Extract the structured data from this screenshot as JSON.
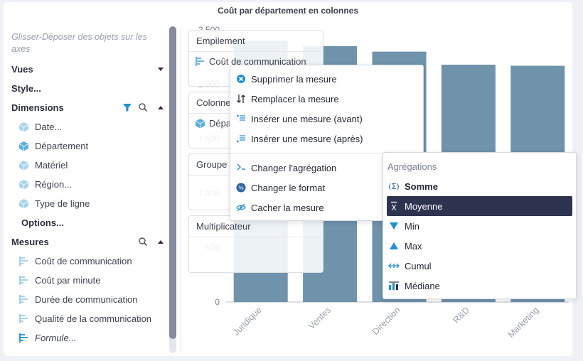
{
  "title": "Coût par département en colonnes",
  "sidebar": {
    "hint": "Glisser-Déposer des objets sur les axes",
    "vues": "Vues",
    "style": "Style...",
    "dimensions_label": "Dimensions",
    "dimensions": [
      "Date...",
      "Département",
      "Matériel",
      "Région...",
      "Type de ligne"
    ],
    "options": "Options...",
    "mesures_label": "Mesures",
    "mesures": [
      "Coût de communication",
      "Coût par minute",
      "Durée de communication",
      "Qualité de la communication",
      "Formule..."
    ]
  },
  "panels": {
    "empilement": "Empilement",
    "empilement_item": "Coût de communication",
    "colonnes": "Colonnes",
    "colonnes_item": "Département",
    "groupe": "Groupe",
    "multiplicateur": "Multiplicateur"
  },
  "context_menu": {
    "items": [
      "Supprimer la mesure",
      "Remplacer la mesure",
      "Insérer une mesure (avant)",
      "Insérer une mesure (après)",
      "Changer l'agrégation",
      "Changer le format",
      "Cacher la mesure"
    ]
  },
  "aggregations": {
    "header": "Agrégations",
    "items": [
      {
        "label": "Somme",
        "icon": "sigma-icon",
        "bold": true
      },
      {
        "label": "Moyenne",
        "icon": "xbar-icon",
        "selected": true
      },
      {
        "label": "Min",
        "icon": "triangle-down-icon"
      },
      {
        "label": "Max",
        "icon": "triangle-up-icon"
      },
      {
        "label": "Cumul",
        "icon": "cumul-icon"
      },
      {
        "label": "Médiane",
        "icon": "median-icon"
      }
    ]
  },
  "colors": {
    "bar": "#6f93ab",
    "accent": "#2e3350",
    "icon_blue": "#1e90d6",
    "dim_icon": "#a9d3ea"
  },
  "chart_data": {
    "type": "bar",
    "categories": [
      "Juridique",
      "Ventes",
      "Direction",
      "R&D",
      "Marketing"
    ],
    "values": [
      2400,
      2350,
      2300,
      2180,
      2170
    ],
    "yticks": [
      0,
      500,
      1000,
      1500,
      2000,
      2500
    ],
    "ylim": [
      0,
      2500
    ]
  }
}
